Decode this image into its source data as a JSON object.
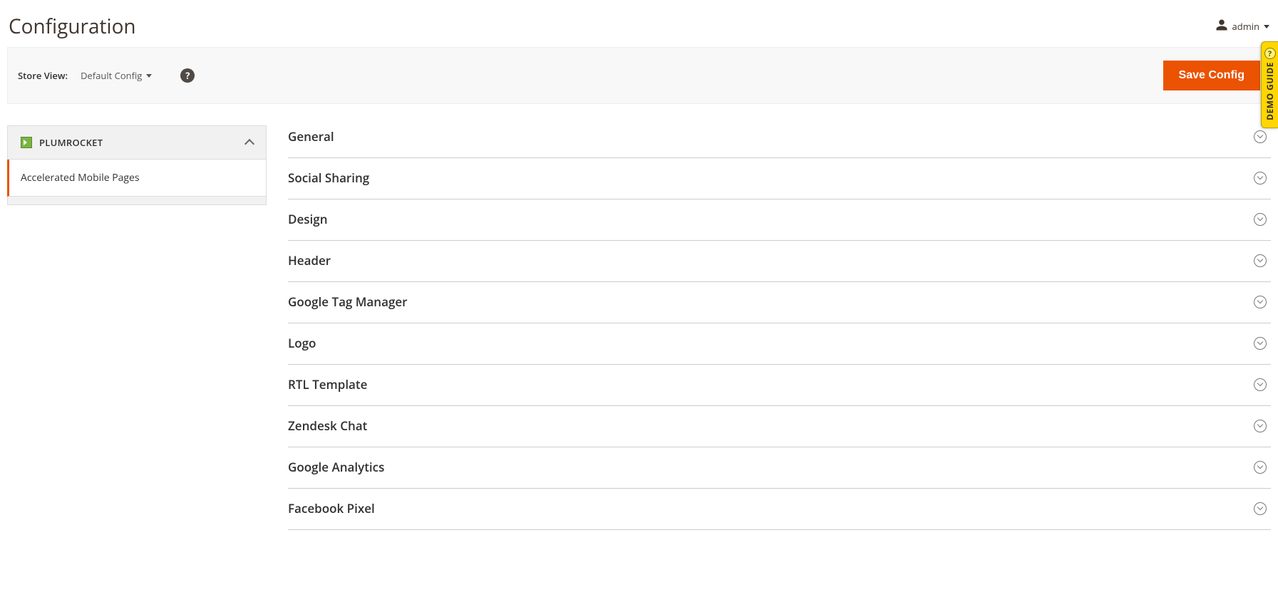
{
  "header": {
    "title": "Configuration",
    "admin_label": "admin"
  },
  "toolbar": {
    "store_view_label": "Store View:",
    "store_view_value": "Default Config",
    "save_label": "Save Config"
  },
  "sidebar": {
    "group_name": "PLUMROCKET",
    "active_item": "Accelerated Mobile Pages"
  },
  "sections": [
    {
      "label": "General"
    },
    {
      "label": "Social Sharing"
    },
    {
      "label": "Design"
    },
    {
      "label": "Header"
    },
    {
      "label": "Google Tag Manager"
    },
    {
      "label": "Logo"
    },
    {
      "label": "RTL Template"
    },
    {
      "label": "Zendesk Chat"
    },
    {
      "label": "Google Analytics"
    },
    {
      "label": "Facebook Pixel"
    }
  ],
  "demo_guide": {
    "label": "DEMO GUIDE"
  }
}
